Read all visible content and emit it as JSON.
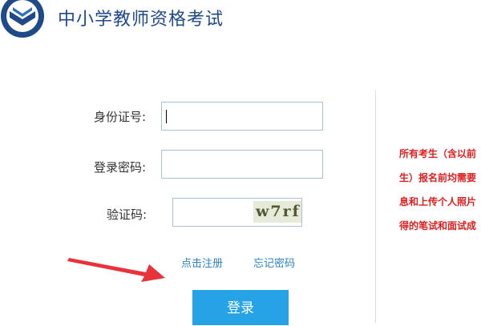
{
  "header": {
    "title": "中小学教师资格考试"
  },
  "login_form": {
    "id_label": "身份证号:",
    "id_value": "",
    "password_label": "登录密码:",
    "password_value": "",
    "captcha_label": "验证码:",
    "captcha_value": "",
    "captcha_image_text": "w7rf",
    "register_link": "点击注册",
    "forgot_password_link": "忘记密码",
    "login_button": "登录"
  },
  "notice": {
    "lines": [
      "所有考生（含以前",
      "生）报名前均需要",
      "息和上传个人照片",
      "得的笔试和面试成"
    ]
  },
  "colors": {
    "title": "#1f4a8a",
    "link": "#2a83c6",
    "button": "#25a3e6",
    "notice_text": "#e02020",
    "annotation_arrow": "#e8323c"
  },
  "icons": {
    "logo": "book-shield-logo-icon",
    "annotation": "red-arrow-icon"
  }
}
